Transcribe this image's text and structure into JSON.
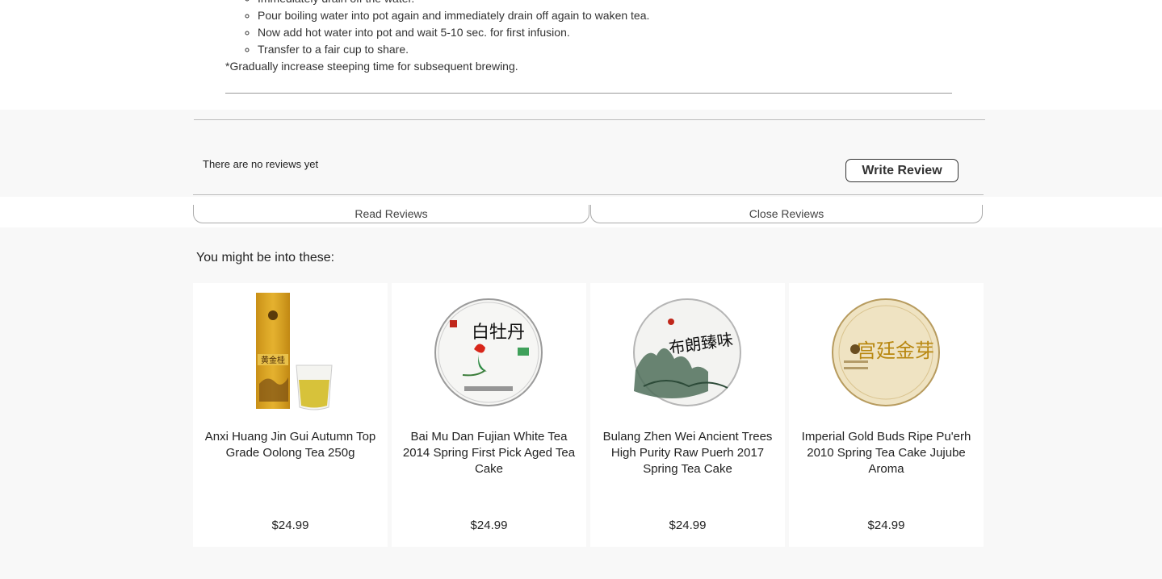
{
  "instructions": {
    "steps": [
      "Immediately drain off the water.",
      "Pour boiling water into pot again and immediately drain off again to waken tea.",
      "Now add hot water into pot and wait 5-10 sec. for first infusion.",
      "Transfer to a fair cup to share."
    ],
    "note": "*Gradually increase steeping time for subsequent brewing."
  },
  "reviews": {
    "empty_text": "There are no reviews yet",
    "write_label": "Write Review",
    "read_label": "Read Reviews",
    "close_label": "Close Reviews"
  },
  "recommendations": {
    "title": "You might be into these:",
    "products": [
      {
        "name": "Anxi Huang Jin Gui Autumn Top Grade Oolong Tea 250g",
        "price": "$24.99",
        "image_text": "黄金桂"
      },
      {
        "name": "Bai Mu Dan Fujian White Tea 2014 Spring First Pick Aged Tea Cake",
        "price": "$24.99",
        "image_text": "白牡丹"
      },
      {
        "name": "Bulang Zhen Wei Ancient Trees High Purity Raw Puerh 2017 Spring Tea Cake",
        "price": "$24.99",
        "image_text": "布朗臻味"
      },
      {
        "name": "Imperial Gold Buds Ripe Pu'erh 2010 Spring Tea Cake Jujube Aroma",
        "price": "$24.99",
        "image_text": "宫廷金芽"
      }
    ]
  },
  "colors": {
    "page_bg": "#f8f8f8",
    "card_bg": "#ffffff",
    "rule": "#bbbbbb",
    "tea_gold": "#d9a21c"
  }
}
